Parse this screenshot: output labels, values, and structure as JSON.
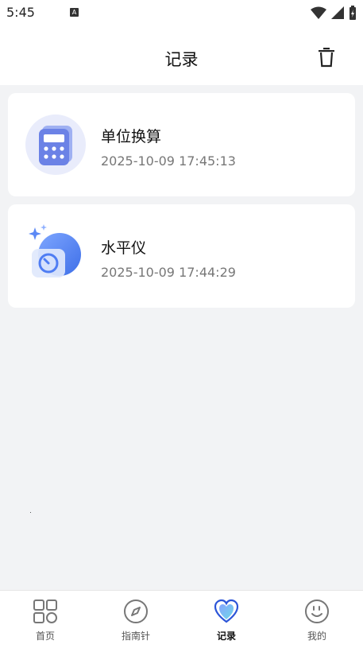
{
  "status": {
    "time": "5:45",
    "badge": "A"
  },
  "header": {
    "title": "记录"
  },
  "records": [
    {
      "title": "单位换算",
      "time": "2025-10-09 17:45:13",
      "icon": "calculator-icon"
    },
    {
      "title": "水平仪",
      "time": "2025-10-09 17:44:29",
      "icon": "level-icon"
    }
  ],
  "tabs": [
    {
      "label": "首页",
      "icon": "home-grid-icon"
    },
    {
      "label": "指南针",
      "icon": "compass-icon"
    },
    {
      "label": "记录",
      "icon": "heart-icon",
      "active": true
    },
    {
      "label": "我的",
      "icon": "smiley-icon"
    }
  ],
  "colors": {
    "accent": "#4f7df3",
    "background": "#f2f3f5"
  }
}
